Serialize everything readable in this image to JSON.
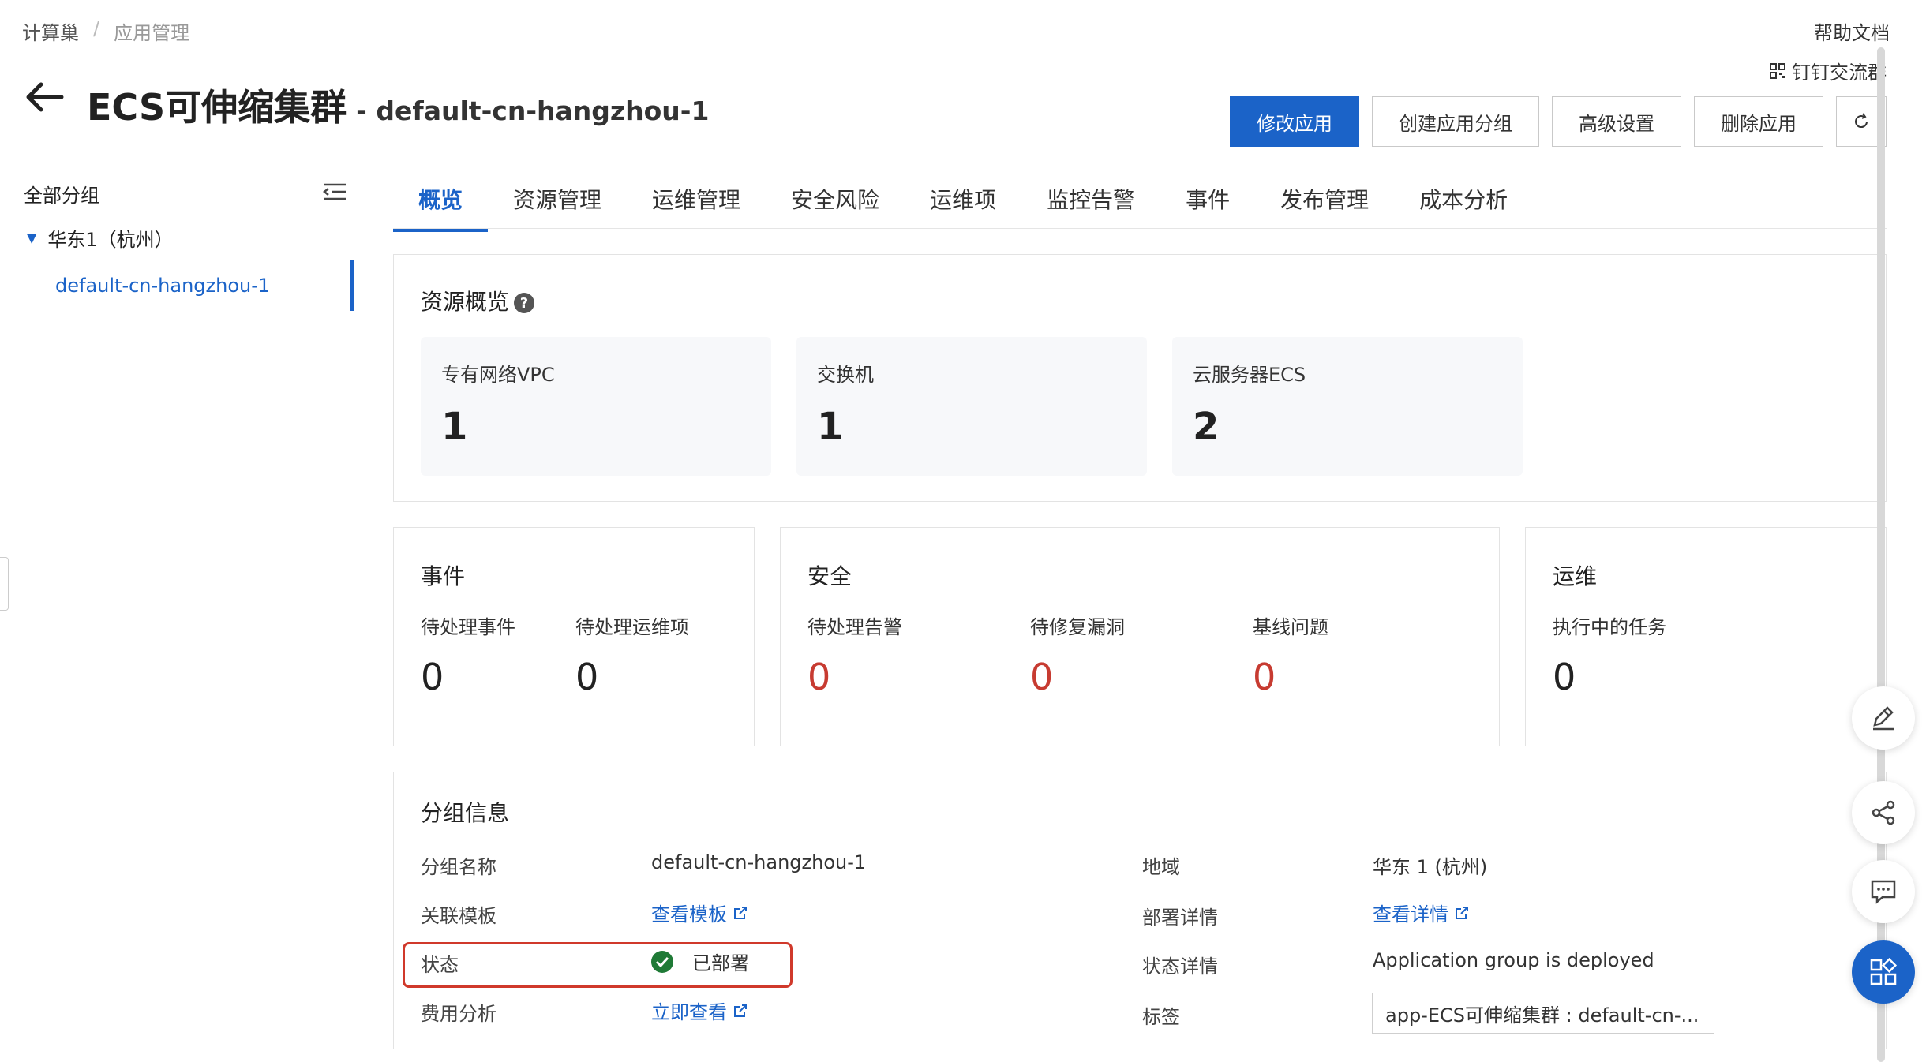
{
  "breadcrumb": [
    "计算巢",
    "应用管理"
  ],
  "breadcrumb_sep": "/",
  "header": {
    "help_label": "帮助文档",
    "dingtalk_label": "钉钉交流群",
    "title": "ECS可伸缩集群",
    "subtitle": "- default-cn-hangzhou-1"
  },
  "actions": {
    "modify": "修改应用",
    "create_group": "创建应用分组",
    "advanced": "高级设置",
    "delete": "删除应用"
  },
  "sidebar": {
    "title": "全部分组",
    "region": "华东1（杭州）",
    "item": "default-cn-hangzhou-1"
  },
  "tabs": [
    "概览",
    "资源管理",
    "运维管理",
    "安全风险",
    "运维项",
    "监控告警",
    "事件",
    "发布管理",
    "成本分析"
  ],
  "resource_overview": {
    "title": "资源概览",
    "help_glyph": "?",
    "items": [
      {
        "label": "专有网络VPC",
        "value": "1"
      },
      {
        "label": "交换机",
        "value": "1"
      },
      {
        "label": "云服务器ECS",
        "value": "2"
      }
    ]
  },
  "events_card": {
    "title": "事件",
    "metrics": [
      {
        "label": "待处理事件",
        "value": "0"
      },
      {
        "label": "待处理运维项",
        "value": "0"
      }
    ]
  },
  "security_card": {
    "title": "安全",
    "metrics": [
      {
        "label": "待处理告警",
        "value": "0"
      },
      {
        "label": "待修复漏洞",
        "value": "0"
      },
      {
        "label": "基线问题",
        "value": "0"
      }
    ]
  },
  "ops_card": {
    "title": "运维",
    "metrics": [
      {
        "label": "执行中的任务",
        "value": "0"
      }
    ]
  },
  "group_info": {
    "title": "分组信息",
    "group_name_label": "分组名称",
    "group_name": "default-cn-hangzhou-1",
    "template_label": "关联模板",
    "template_link": "查看模板",
    "status_label": "状态",
    "status_value": "已部署",
    "cost_label": "费用分析",
    "cost_link": "立即查看",
    "region_label": "地域",
    "region_value": "华东 1 (杭州)",
    "deploy_label": "部署详情",
    "deploy_link": "查看详情",
    "status_detail_label": "状态详情",
    "status_detail_value": "Application group is deployed",
    "tag_label": "标签",
    "tag_value": "app-ECS可伸缩集群 : default-cn-..."
  },
  "colors": {
    "primary": "#1b63c8",
    "danger": "#c73b31",
    "success": "#1f7a36"
  }
}
